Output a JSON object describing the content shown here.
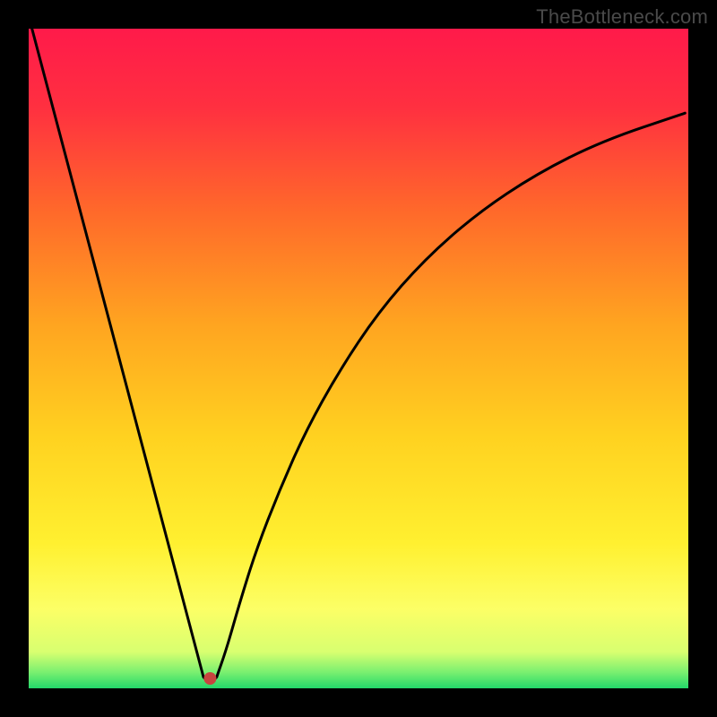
{
  "watermark": "TheBottleneck.com",
  "chart_data": {
    "type": "line",
    "title": "",
    "xlabel": "",
    "ylabel": "",
    "xlim": [
      0,
      1
    ],
    "ylim": [
      0,
      1
    ],
    "gradient_stops": [
      {
        "offset": 0.0,
        "color": "#ff1a4a"
      },
      {
        "offset": 0.12,
        "color": "#ff3040"
      },
      {
        "offset": 0.28,
        "color": "#ff6a2a"
      },
      {
        "offset": 0.45,
        "color": "#ffa520"
      },
      {
        "offset": 0.62,
        "color": "#ffd220"
      },
      {
        "offset": 0.78,
        "color": "#fff030"
      },
      {
        "offset": 0.88,
        "color": "#fcff66"
      },
      {
        "offset": 0.945,
        "color": "#d8ff70"
      },
      {
        "offset": 0.975,
        "color": "#7cf070"
      },
      {
        "offset": 1.0,
        "color": "#23d86a"
      }
    ],
    "curve": {
      "left_line": {
        "x0": 0.005,
        "y0": 0.0,
        "x1": 0.265,
        "y1": 0.983
      },
      "dip_bottom": {
        "x": 0.275,
        "y": 0.985
      },
      "right_points": [
        {
          "x": 0.285,
          "y": 0.983
        },
        {
          "x": 0.3,
          "y": 0.94
        },
        {
          "x": 0.32,
          "y": 0.87
        },
        {
          "x": 0.345,
          "y": 0.79
        },
        {
          "x": 0.38,
          "y": 0.7
        },
        {
          "x": 0.42,
          "y": 0.61
        },
        {
          "x": 0.47,
          "y": 0.52
        },
        {
          "x": 0.53,
          "y": 0.43
        },
        {
          "x": 0.6,
          "y": 0.35
        },
        {
          "x": 0.68,
          "y": 0.28
        },
        {
          "x": 0.77,
          "y": 0.22
        },
        {
          "x": 0.87,
          "y": 0.17
        },
        {
          "x": 0.995,
          "y": 0.128
        }
      ]
    },
    "marker": {
      "x": 0.275,
      "y": 0.985,
      "color": "#c8453f",
      "radius": 7
    }
  }
}
